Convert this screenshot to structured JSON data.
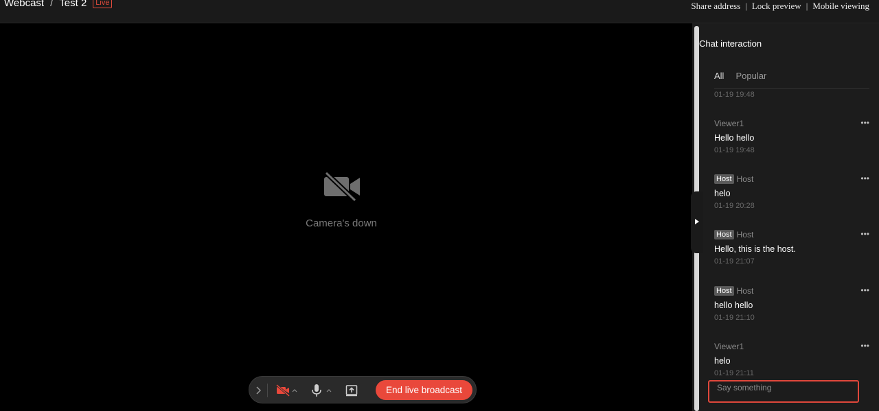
{
  "header": {
    "breadcrumb_root": "Webcast",
    "breadcrumb_separator": "/",
    "breadcrumb_current": "Test 2",
    "live_badge": "Live",
    "links": [
      "Share address",
      "Lock preview",
      "Mobile viewing"
    ],
    "link_separator": "|"
  },
  "video": {
    "camera_status": "Camera's down",
    "camera_icon": "video-off-icon"
  },
  "controls": {
    "expand_icon": "chevron-right-icon",
    "camera_icon": "camera-off-icon",
    "mic_icon": "microphone-icon",
    "share_icon": "upload-screen-icon",
    "end_label": "End live broadcast",
    "accent_color": "#e9483b"
  },
  "chat": {
    "title": "Chat interaction",
    "tabs": [
      "All",
      "Popular"
    ],
    "first_time": "01-19 19:48",
    "messages": [
      {
        "badge": "",
        "user": "Viewer1",
        "text": "Hello hello",
        "time": "01-19 19:48"
      },
      {
        "badge": "Host",
        "user": "Host",
        "text": "helo",
        "time": "01-19 20:28"
      },
      {
        "badge": "Host",
        "user": "Host",
        "text": "Hello, this is the host.",
        "time": "01-19 21:07"
      },
      {
        "badge": "Host",
        "user": "Host",
        "text": "hello hello",
        "time": "01-19 21:10"
      },
      {
        "badge": "",
        "user": "Viewer1",
        "text": "helo",
        "time": "01-19 21:11"
      }
    ],
    "more_label": "•••",
    "input_placeholder": "Say something"
  }
}
